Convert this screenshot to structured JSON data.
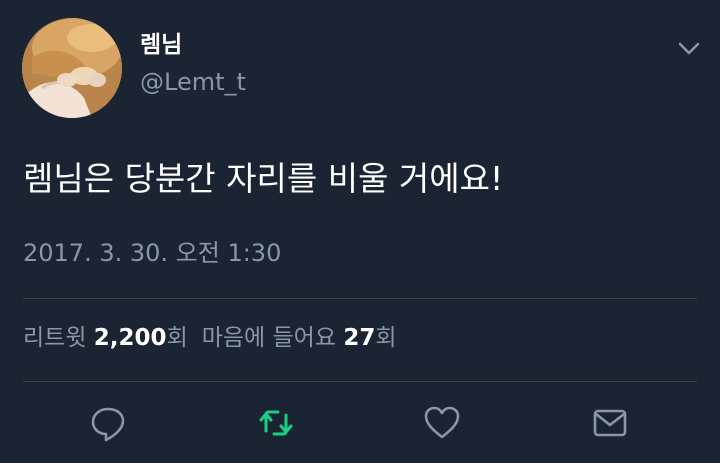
{
  "user": {
    "display_name": "렘님",
    "handle": "@Lemt_t"
  },
  "tweet": {
    "text": "렘님은 당분간 자리를 비울 거에요!",
    "timestamp": "2017. 3. 30. 오전 1:30"
  },
  "stats": {
    "retweets_label": "리트윗",
    "retweets_count": "2,200",
    "retweets_unit": "회",
    "likes_label": "마음에 들어요",
    "likes_count": "27",
    "likes_unit": "회"
  },
  "actions": [
    {
      "name": "reply",
      "icon": "reply-icon"
    },
    {
      "name": "retweet",
      "icon": "retweet-icon"
    },
    {
      "name": "like",
      "icon": "heart-icon"
    },
    {
      "name": "direct-message",
      "icon": "mail-icon"
    }
  ],
  "colors": {
    "background": "#1a2433",
    "primary_text": "#ffffff",
    "secondary_text": "#8899a6",
    "divider": "#38444d",
    "retweet_accent": "#19cf86"
  }
}
